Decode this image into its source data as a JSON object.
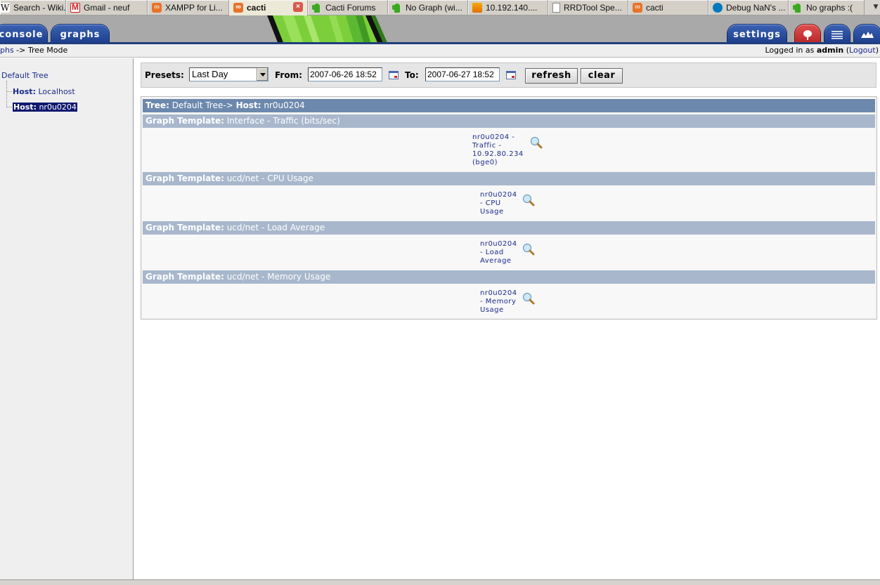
{
  "browser": {
    "tabs": [
      {
        "label": "Search - Wiki...",
        "icon": "wikipedia-icon",
        "active": false
      },
      {
        "label": "Gmail - neuf",
        "icon": "gmail-icon",
        "active": false
      },
      {
        "label": "XAMPP for Li...",
        "icon": "xampp-icon",
        "active": false
      },
      {
        "label": "cacti",
        "icon": "xampp-icon",
        "active": true
      },
      {
        "label": "Cacti Forums",
        "icon": "cacti-icon",
        "active": false
      },
      {
        "label": "No Graph (wi...",
        "icon": "cacti-icon",
        "active": false
      },
      {
        "label": "10.192.140....",
        "icon": "phpmyadmin-icon",
        "active": false
      },
      {
        "label": "RRDTool Spe...",
        "icon": "document-icon",
        "active": false
      },
      {
        "label": "cacti",
        "icon": "xampp-icon",
        "active": false
      },
      {
        "label": "Debug NaN's ...",
        "icon": "drupal-icon",
        "active": false
      },
      {
        "label": "No graphs :(",
        "icon": "cacti-icon",
        "active": false
      }
    ],
    "close_glyph": "×",
    "overflow_glyph": "▼"
  },
  "header": {
    "nav": {
      "console": "console",
      "graphs": "graphs",
      "settings": "settings"
    },
    "view_modes": [
      "tree-view",
      "list-view",
      "preview-view"
    ]
  },
  "breadcrumb": {
    "parent": "phs",
    "separator": " -> ",
    "current": "Tree Mode"
  },
  "login": {
    "prefix": "Logged in as ",
    "user": "admin",
    "open": " (",
    "logout": "Logout",
    "close": ")"
  },
  "tree": {
    "root": "Default Tree",
    "nodes": [
      {
        "prefix": "Host:",
        "name": " Localhost",
        "selected": false
      },
      {
        "prefix": "Host:",
        "name": " nr0u0204",
        "selected": true
      }
    ]
  },
  "filter": {
    "presets_label": "Presets:",
    "presets_value": "Last Day",
    "from_label": "From:",
    "from_value": "2007-06-26 18:52",
    "to_label": "To:",
    "to_value": "2007-06-27 18:52",
    "refresh": "refresh",
    "clear": "clear"
  },
  "content": {
    "tree_label": "Tree:",
    "tree_value": " Default Tree-> ",
    "host_label": "Host:",
    "host_value": " nr0u0204",
    "template_label": "Graph Template:",
    "templates": [
      {
        "name": " Interface - Traffic (bits/sec)",
        "graph_lines": [
          "nr0u0204 -",
          "Traffic -",
          "10.92.80.234",
          "(bge0)"
        ]
      },
      {
        "name": " ucd/net - CPU Usage",
        "graph_lines": [
          "nr0u0204",
          "- CPU",
          "Usage"
        ]
      },
      {
        "name": " ucd/net - Load Average",
        "graph_lines": [
          "nr0u0204",
          "- Load",
          "Average"
        ]
      },
      {
        "name": " ucd/net - Memory Usage",
        "graph_lines": [
          "nr0u0204",
          "- Memory",
          "Usage"
        ]
      }
    ]
  }
}
